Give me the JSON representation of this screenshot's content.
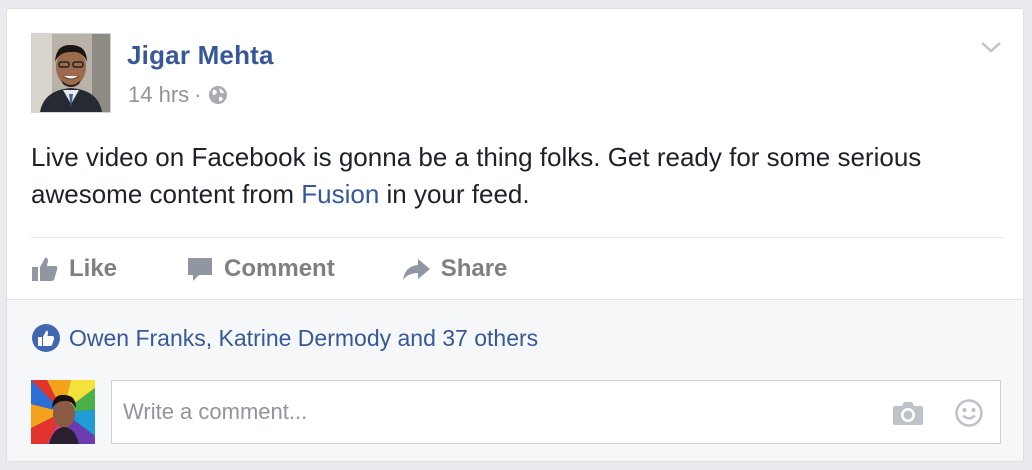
{
  "post": {
    "author": "Jigar Mehta",
    "time": "14 hrs",
    "separator": "·",
    "text_before": "Live video on Facebook is gonna be a thing folks. Get ready for some serious awesome content from ",
    "text_link": "Fusion",
    "text_after": " in your feed."
  },
  "actions": {
    "like": "Like",
    "comment": "Comment",
    "share": "Share"
  },
  "likes_summary": "Owen Franks, Katrine Dermody and 37 others",
  "comment_input": {
    "placeholder": "Write a comment...",
    "value": ""
  },
  "icons": {
    "privacy": "globe-icon",
    "options": "chevron-down-icon",
    "like": "thumbs-up-icon",
    "comment": "speech-bubble-icon",
    "share": "share-arrow-icon",
    "likes_badge": "like-badge-icon",
    "camera": "camera-icon",
    "emoji": "smiley-icon"
  },
  "colors": {
    "link": "#365899",
    "muted": "#90949c",
    "action": "#7f7f7f",
    "like_badge": "#4267b2",
    "background": "#e9ebee"
  }
}
